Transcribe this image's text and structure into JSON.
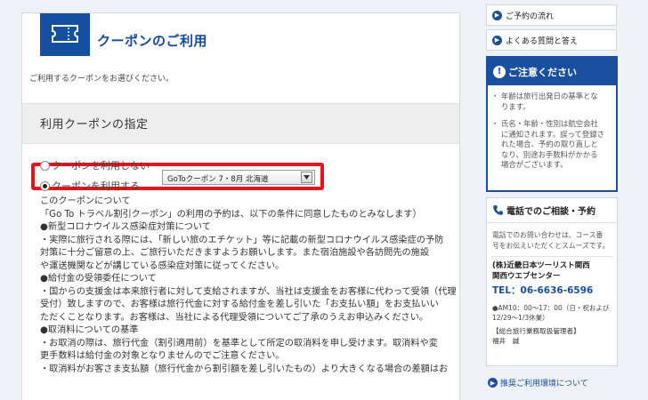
{
  "main": {
    "title": "クーポンのご利用",
    "subtitle": "ご利用するクーポンをお選びください。",
    "section_title": "利用クーポンの指定",
    "options": [
      {
        "label": "クーポンを利用しない",
        "checked": false
      },
      {
        "label": "クーポンを利用する",
        "checked": true
      }
    ],
    "coupon_select": {
      "selected": "GoToクーポン 7・8月 北海道"
    },
    "body_lines": [
      "このクーポンについて",
      "「Go To トラベル割引クーポン」の利用の予約は、以下の条件に同意したものとみなします）",
      "●新型コロナウイルス感染症対策について",
      "・実際に旅行される際には、「新しい旅のエチケット」等に記載の新型コロナウイルス感染症の予防",
      "対策に十分ご留意の上、ご旅行いただきますようお願いします。また宿泊施設や各訪問先の施設",
      "や運送機関などが講じている感染症対策に従ってください。",
      "●給付金の受領委任について",
      "・国からの支援金は本来旅行者に対して支給されますが、当社は支援金をお客様に代わって受領（代理",
      "受付）致しますので、お客様は旅行代金に対する給付金を差し引いた「お支払い額」をお支払いい",
      "ただくことなります。お客様は、当社による代理受領についてご了承のうえお申込みください。",
      "●取消料についての基準",
      "・お取消の際は、旅行代金（割引適用前）を基準として所定の取消料を申し受けます。取消料や変",
      "更手数料は給付金の対象となりませんのでご注意ください。",
      "・取消料がお客さま支払額（旅行代金から割引額を差し引いたもの）より大きくなる場合の差額はお"
    ]
  },
  "sidebar": {
    "links": [
      {
        "label": "ご予約の流れ"
      },
      {
        "label": "よくある質問と答え"
      }
    ],
    "notice": {
      "title": "ご注意ください",
      "items": [
        [
          "年齢は旅行出発日の基準とな",
          "ります。"
        ],
        [
          "氏名・年齢・性別は航空会社",
          "に通知されます。誤って登録さ",
          "れた場合、予約の取り直しと",
          "なり、別途お手数料がかかる",
          "場合がございます。"
        ]
      ]
    },
    "phone": {
      "title": "電話でのご相談・予約",
      "desc": [
        "電話でのお問い合わせは、コース番",
        "号をお伝えいただくとスムーズです。"
      ],
      "company": [
        "(株)近畿日本ツーリスト関西",
        "関西ウエブセンター"
      ],
      "tel": "TEL：06-6636-6596",
      "hours": [
        "●AM10：00～17：00（日・祝および",
        "12/29～1/3休業）"
      ],
      "manager": [
        "【総合旅行業務取扱管理者】",
        "福井　誠"
      ]
    },
    "env_link": "推奨ご利用環境について"
  },
  "colors": {
    "brand_blue": "#1a4e9e",
    "highlight_red": "#e8141c"
  }
}
